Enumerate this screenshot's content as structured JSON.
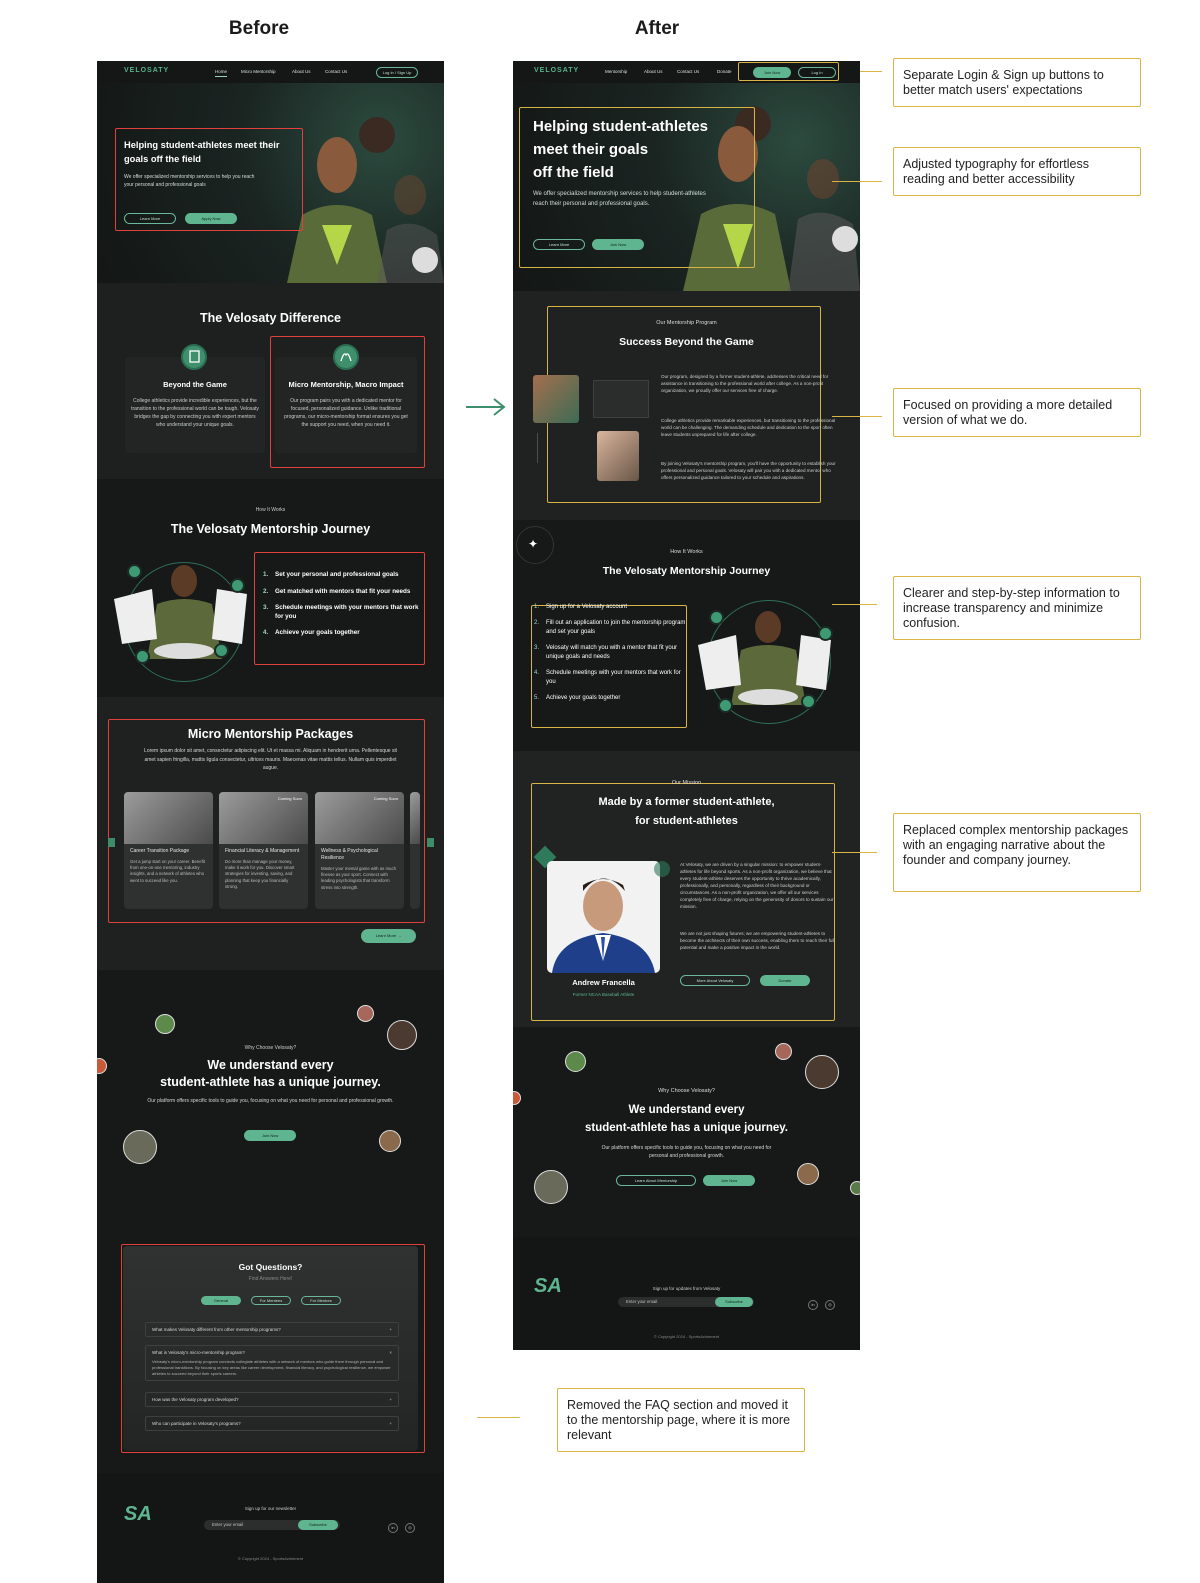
{
  "headings": {
    "before": "Before",
    "after": "After"
  },
  "before": {
    "nav": {
      "logo": "VELOSATY",
      "links": [
        "Home",
        "Micro Mentorship",
        "About Us",
        "Contact Us"
      ],
      "auth": "Log In / Sign Up"
    },
    "hero": {
      "title": "Helping student-athletes meet their goals off the field",
      "subtitle": "We offer specialized mentorship services to help you reach your personal and professional goals",
      "learn_more": "Learn More",
      "apply_now": "Apply Now"
    },
    "difference": {
      "title": "The Velosaty Difference",
      "cards": [
        {
          "title": "Beyond the Game",
          "text": "College athletics provide incredible experiences, but the transition to the professional world can be tough. Velosaty bridges the gap by connecting you with expert mentors who understand your unique goals.",
          "icon": "book-icon"
        },
        {
          "title": "Micro Mentorship, Macro Impact",
          "text": "Our program pairs you with a dedicated mentor for focused, personalized guidance. Unlike traditional programs, our micro-mentorship format ensures you get the support you need, when you need it.",
          "icon": "hands-icon"
        }
      ]
    },
    "journey": {
      "eyebrow": "How It Works",
      "title": "The Velosaty Mentorship Journey",
      "steps": [
        "Set your personal and professional goals",
        "Get matched with mentors that fit your needs",
        "Schedule meetings with your mentors that work for you",
        "Achieve your goals together"
      ]
    },
    "packages": {
      "title": "Micro Mentorship Packages",
      "intro": "Lorem ipsum dolor sit amet, consectetur adipiscing elit. Ut et massa mi. Aliquam in hendrerit urna. Pellentesque sit amet sapien fringilla, mattis ligula consectetur, ultrices mauris. Maecenas vitae mattis tellus. Nullam quis imperdiet augue.",
      "items": [
        {
          "name": "Career Transition Package",
          "desc": "Get a jump start on your career. Benefit from one-on-one mentoring, industry insights, and a network of athletes who went to succeed like you.",
          "badge": ""
        },
        {
          "name": "Financial Literacy & Management",
          "desc": "Do more than manage your money, make it work for you. Discover smart strategies for investing, saving, and planning that keep you financially strong.",
          "badge": "Coming Soon"
        },
        {
          "name": "Wellness & Psychological Resilience",
          "desc": "Master your mental game with as much finesse as your sport. Connect with leading psychologists that transform stress into strength.",
          "badge": "Coming Soon"
        }
      ],
      "cta": "Learn More →"
    },
    "why": {
      "eyebrow": "Why Choose Velosaty?",
      "title_line1": "We understand every",
      "title_line2": "student-athlete has a unique journey.",
      "text": "Our platform offers specific tools to guide you, focusing on what you need for personal and professional growth.",
      "cta": "Join Now"
    },
    "faq": {
      "title": "Got Questions?",
      "subtitle": "Find Answers Here!",
      "tabs": [
        "General",
        "For Mentees",
        "For Mentors"
      ],
      "q1": "What makes Velosaty different from other mentorship programs?",
      "q2": "What is Velosaty's micro-mentorship program?",
      "a2": "Velosaty's micro-mentorship program connects collegiate athletes with a network of mentors who guide them through personal and professional transitions. By focusing on key areas like career development, financial literacy, and psychological resilience, we empower athletes to succeed beyond their sports careers.",
      "q3": "How was the Velosaty program developed?",
      "q4": "Who can participate in Velosaty's programs?"
    },
    "footer": {
      "logo": "SA",
      "signup": "Sign up for our newsletter",
      "email_placeholder": "Enter your email",
      "subscribe": "Subscribe",
      "copyright": "© Copyright 2024 - SportsAchiement"
    }
  },
  "after": {
    "nav": {
      "logo": "VELOSATY",
      "links": [
        "Mentorship",
        "About Us",
        "Contact Us",
        "Donate"
      ],
      "join": "Join Now",
      "login": "Log In"
    },
    "hero": {
      "title_line1": "Helping student-athletes",
      "title_line2": "meet their goals",
      "title_line3": "off the field",
      "subtitle": "We offer specialized mentorship services to help student-athletes reach their personal and professional goals.",
      "learn_more": "Learn More",
      "join_now": "Join Now"
    },
    "program": {
      "eyebrow": "Our Mentorship Program",
      "title": "Success Beyond the Game",
      "p1": "Our program, designed by a former student-athlete, addresses the critical need for assistance in transitioning to the professional world after college. As a non-profit organization, we proudly offer our services free of charge.",
      "p2": "College athletics provide remarkable experiences, but transitioning to the professional world can be challenging. The demanding schedule and dedication to the sport often leave students unprepared for life after college.",
      "p3": "By joining Velosaty's mentorship program, you'll have the opportunity to establish your professional and personal goals. Velosaty will pair you with a dedicated mentor who offers personalized guidance tailored to your schedule and aspirations."
    },
    "journey": {
      "eyebrow": "How It Works",
      "title": "The Velosaty Mentorship Journey",
      "steps": [
        "Sign up for a Velosaty account",
        "Fill out an application to join the mentorship program and set your goals",
        "Velosaty will match you with a mentor that fit your unique goals and needs",
        "Schedule meetings with your mentors that work for you",
        "Achieve your goals together"
      ]
    },
    "mission": {
      "eyebrow": "Our Mission",
      "title_line1": "Made by a former student-athlete,",
      "title_line2": "for student-athletes",
      "p1": "At Velosaty, we are driven by a singular mission: to empower student-athletes for life beyond sports. As a non-profit organization, we believe that every student-athlete deserves the opportunity to thrive academically, professionally, and personally, regardless of their background or circumstances. As a non-profit organization, we offer all our services completely free of charge, relying on the generosity of donors to sustain our mission.",
      "p2": "We are not just shaping futures; we are empowering student-athletes to become the architects of their own success, enabling them to reach their full potential and make a positive impact in the world.",
      "name": "Andrew Francella",
      "role": "Former NCAA Baseball Athlete",
      "more": "More About Velosaty",
      "donate": "Donate"
    },
    "why": {
      "eyebrow": "Why Choose Velosaty?",
      "title_line1": "We understand every",
      "title_line2": "student-athlete has a unique journey.",
      "text": "Our platform offers specific tools to guide you, focusing on what you need for personal and professional growth.",
      "learn": "Learn About Mentorship",
      "join": "Join Now"
    },
    "footer": {
      "logo": "SA",
      "signup": "Sign up for updates from Velosaty",
      "email_placeholder": "Enter your email",
      "subscribe": "Subscribe",
      "copyright": "© Copyright 2024 - SportsAchiement"
    }
  },
  "annotations": [
    "Separate Login & Sign up buttons to better match users' expectations",
    "Adjusted typography for effortless reading and better accessibility",
    "Focused on providing a more detailed version of what we do.",
    "Clearer and step-by-step information to increase transparency and minimize confusion.",
    "Replaced complex mentorship packages with an engaging narrative about the founder and company journey.",
    "Removed the FAQ section and moved it to the mentorship page, where it is more relevant"
  ],
  "colors": {
    "accent": "#5fb590",
    "highlight_before": "#e2403c",
    "highlight_after": "#d8b444",
    "arrow": "#3f8f6d"
  }
}
